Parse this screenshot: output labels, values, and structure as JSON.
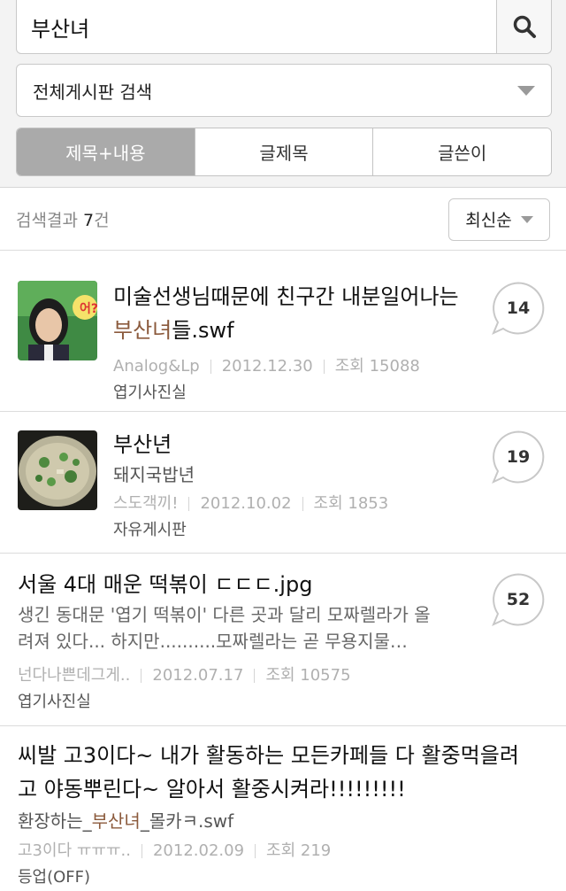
{
  "search": {
    "query": "부산녀"
  },
  "board_select": {
    "label": "전체게시판 검색"
  },
  "tabs": [
    {
      "label": "제목+내용",
      "active": true
    },
    {
      "label": "글제목",
      "active": false
    },
    {
      "label": "글쓴이",
      "active": false
    }
  ],
  "results": {
    "prefix": "검색결과 ",
    "count": "7",
    "suffix": "건"
  },
  "sort": {
    "label": "최신순"
  },
  "colors": {
    "highlight": "#8b5a3c",
    "tab_active": "#aaaaaa"
  },
  "items": [
    {
      "title_line1": "미술선생님때문에 친구간 내분일어나는",
      "title_hl": "부산녀",
      "title_rest": "들.swf",
      "author": "Analog&Lp",
      "date": "2012.12.30",
      "views": "조회 15088",
      "board": "엽기사진실",
      "comments": "14",
      "thumb": "portrait-photo"
    },
    {
      "title": "부산년",
      "subtitle": "돼지국밥년",
      "author": "스도객끼!",
      "date": "2012.10.02",
      "views": "조회 1853",
      "board": "자유게시판",
      "comments": "19",
      "thumb": "food-photo"
    },
    {
      "title": "서울 4대 매운 떡볶이 ㄷㄷㄷ.jpg",
      "snippet_line1": "생긴 동대문 '엽기 떡볶이' 다른 곳과 달리 모짜렐라가 올",
      "snippet_line2": "려져 있다... 하지만..........모짜렐라는 곧 무용지물…",
      "author": "넌다나쁜데그게..",
      "date": "2012.07.17",
      "views": "조회 10575",
      "board": "엽기사진실",
      "comments": "52"
    },
    {
      "title_line1": "씨발 고3이다~ 내가 활동하는 모든카페들 다 활중먹을려",
      "title_line2": "고 야동뿌린다~ 알아서 활중시켜라!!!!!!!!!",
      "sub_pre": "환장하는_",
      "sub_hl": "부산녀",
      "sub_post": "_몰카ㅋ.swf",
      "author": "고3이다 ㅠㅠㅠ..",
      "date": "2012.02.09",
      "views": "조회 219",
      "board": "등업(OFF)"
    }
  ]
}
